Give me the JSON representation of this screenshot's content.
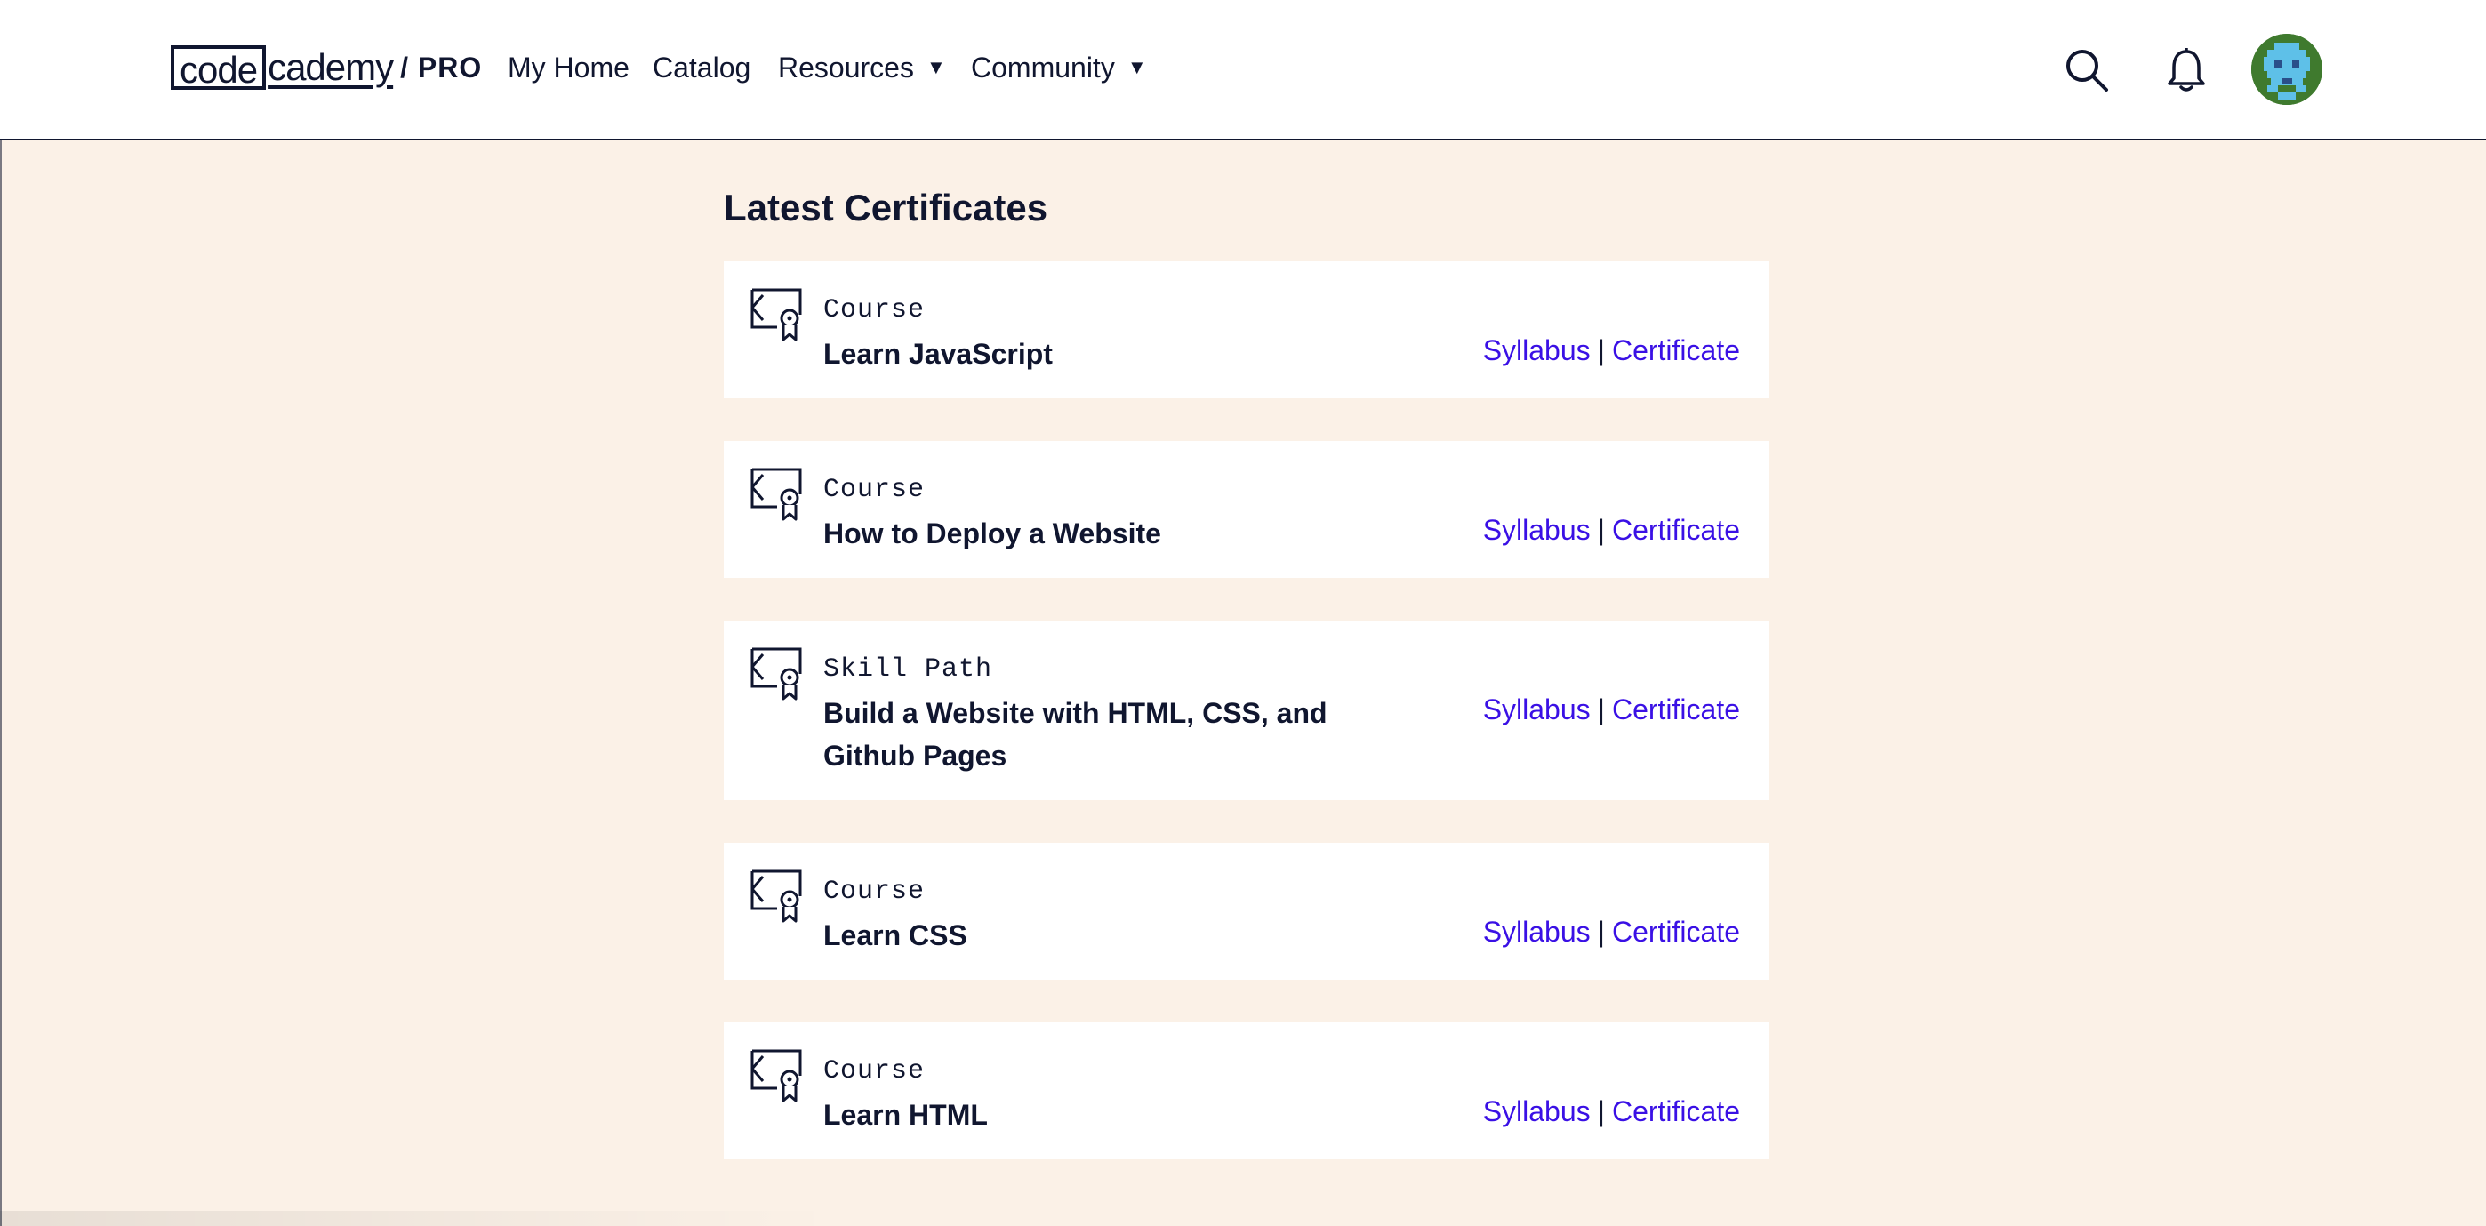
{
  "header": {
    "logo": {
      "code": "code",
      "cademy": "cademy",
      "pro": "/ PRO"
    },
    "nav": [
      {
        "label": "My Home"
      },
      {
        "label": "Catalog"
      },
      {
        "label": "Resources",
        "caret": "▼"
      },
      {
        "label": "Community",
        "caret": "▼"
      }
    ]
  },
  "main": {
    "title": "Latest Certificates",
    "certificates": [
      {
        "kind": "Course",
        "name": "Learn JavaScript",
        "syllabus": "Syllabus",
        "sep": "|",
        "certificate": "Certificate"
      },
      {
        "kind": "Course",
        "name": "How to Deploy a Website",
        "syllabus": "Syllabus",
        "sep": "|",
        "certificate": "Certificate"
      },
      {
        "kind": "Skill Path",
        "name": "Build a Website with HTML, CSS, and Github Pages",
        "syllabus": "Syllabus",
        "sep": "|",
        "certificate": "Certificate"
      },
      {
        "kind": "Course",
        "name": "Learn CSS",
        "syllabus": "Syllabus",
        "sep": "|",
        "certificate": "Certificate"
      },
      {
        "kind": "Course",
        "name": "Learn HTML",
        "syllabus": "Syllabus",
        "sep": "|",
        "certificate": "Certificate"
      }
    ]
  },
  "colors": {
    "background": "#fbf1e7",
    "link": "#3a10e5",
    "text": "#10162f"
  },
  "icons": [
    "search-icon",
    "bell-icon",
    "avatar",
    "certificate-icon"
  ]
}
